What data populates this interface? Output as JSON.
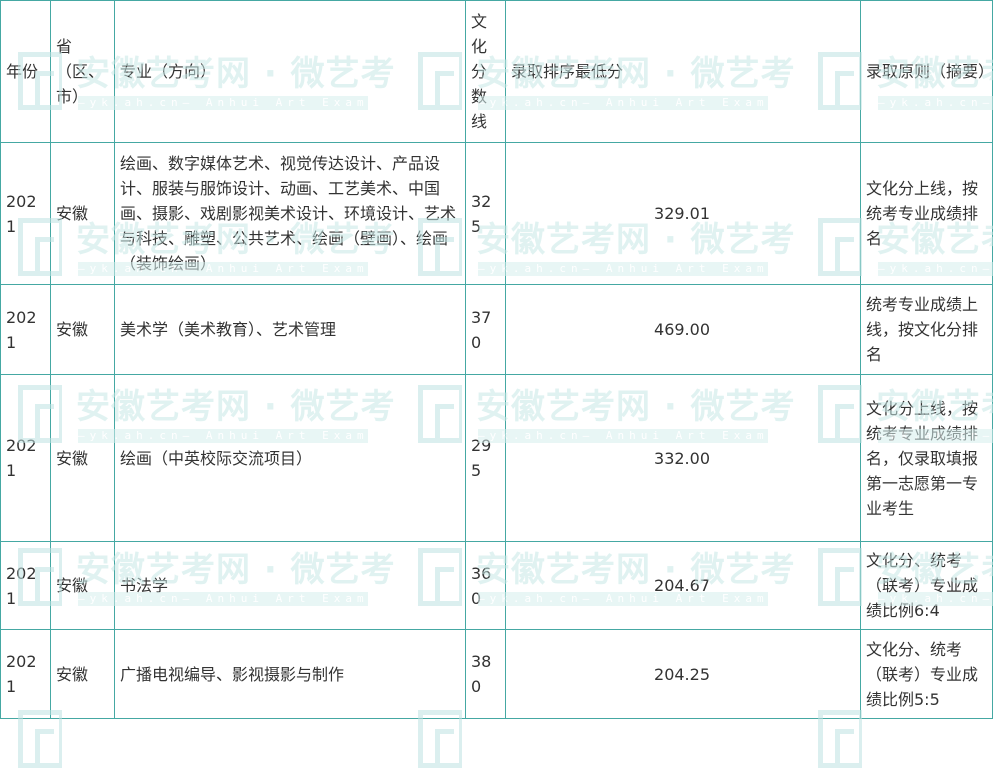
{
  "table": {
    "headers": [
      "年份",
      "省（区、市）",
      "专业（方向）",
      "文化分数线",
      "录取排序最低分",
      "录取原则（摘要）"
    ],
    "rows": [
      {
        "year": "2021",
        "province": "安徽",
        "major": "绘画、数字媒体艺术、视觉传达设计、产品设计、服装与服饰设计、动画、工艺美术、中国画、摄影、戏剧影视美术设计、环境设计、艺术与科技、雕塑、公共艺术、绘画（壁画）、绘画（装饰绘画）",
        "cutoff": "325",
        "min_score": "329.01",
        "principle": "文化分上线，按统考专业成绩排名"
      },
      {
        "year": "2021",
        "province": "安徽",
        "major": "美术学（美术教育）、艺术管理",
        "cutoff": "370",
        "min_score": "469.00",
        "principle": "统考专业成绩上线，按文化分排名"
      },
      {
        "year": "2021",
        "province": "安徽",
        "major": "绘画（中英校际交流项目）",
        "cutoff": "295",
        "min_score": "332.00",
        "principle": "文化分上线，按统考专业成绩排名，仅录取填报第一志愿第一专业考生"
      },
      {
        "year": "2021",
        "province": "安徽",
        "major": "书法学",
        "cutoff": "360",
        "min_score": "204.67",
        "principle": "文化分、统考（联考）专业成绩比例6:4"
      },
      {
        "year": "2021",
        "province": "安徽",
        "major": "广播电视编导、影视摄影与制作",
        "cutoff": "380",
        "min_score": "204.25",
        "principle": "文化分、统考（联考）专业成绩比例5:5"
      }
    ]
  },
  "watermark": {
    "title": "安徽艺考网 · 微艺考",
    "subtitle": "—yk.ah.cn— Anhui Art Exam"
  },
  "colors": {
    "border": "#45a8a3",
    "watermark": "#c7e8e6"
  }
}
